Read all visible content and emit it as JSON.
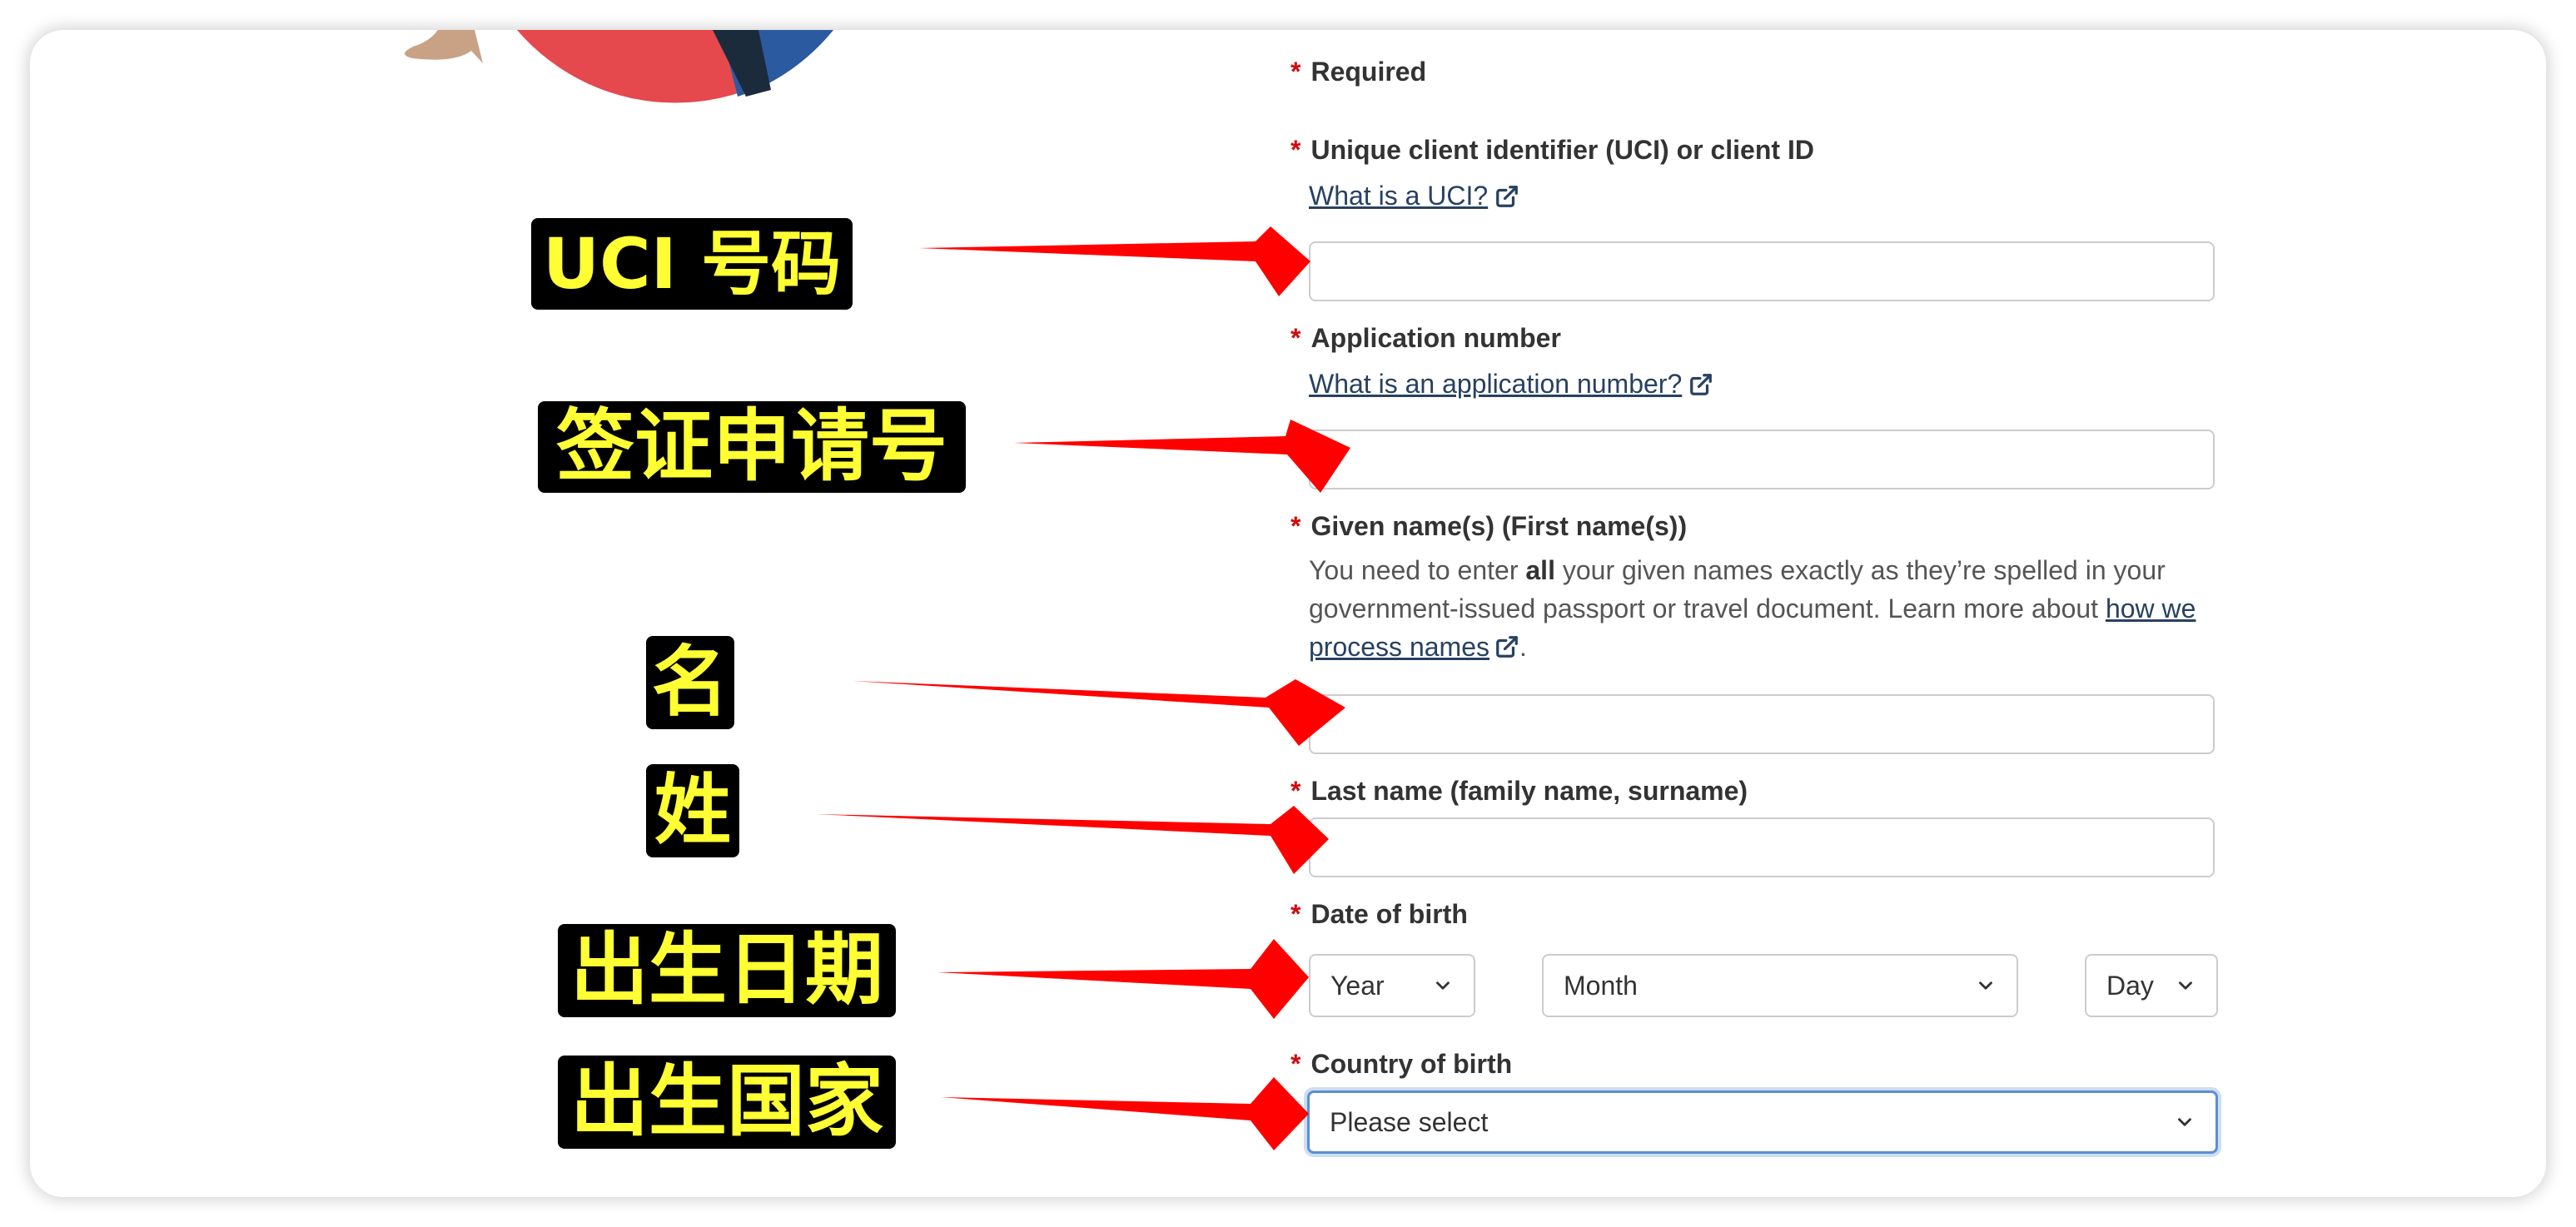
{
  "form": {
    "required_note": "Required",
    "required_marker": "*",
    "uci": {
      "label": "Unique client identifier (UCI) or client ID",
      "help_link": "What is a UCI?",
      "value": ""
    },
    "application_number": {
      "label": "Application number",
      "help_link": "What is an application number?",
      "value": ""
    },
    "given_names": {
      "label": "Given name(s) (First name(s))",
      "hint_before": "You need to enter ",
      "hint_bold": "all",
      "hint_after": " your given names exactly as they’re spelled in your government-issued passport or travel document. Learn more about ",
      "hint_link": "how we process names",
      "hint_end": ".",
      "value": ""
    },
    "last_name": {
      "label": "Last name (family name, surname)",
      "value": ""
    },
    "date_of_birth": {
      "label": "Date of birth",
      "year": "Year",
      "month": "Month",
      "day": "Day"
    },
    "country_of_birth": {
      "label": "Country of birth",
      "value": "Please select"
    }
  },
  "annotations": {
    "uci": "UCI 号码",
    "application_number": "签证申请号",
    "given_name": "名",
    "last_name": "姓",
    "date_of_birth": "出生日期",
    "country_of_birth": "出生国家"
  },
  "colors": {
    "required": "#d3080c",
    "link": "#284162",
    "annotation_text": "#ffff33",
    "annotation_bg": "#000000",
    "arrow": "#ff0000",
    "focus_ring": "#5b8fd6"
  },
  "icons": {
    "external_link": "external-link-icon",
    "dropdown": "chevron-down-icon"
  }
}
